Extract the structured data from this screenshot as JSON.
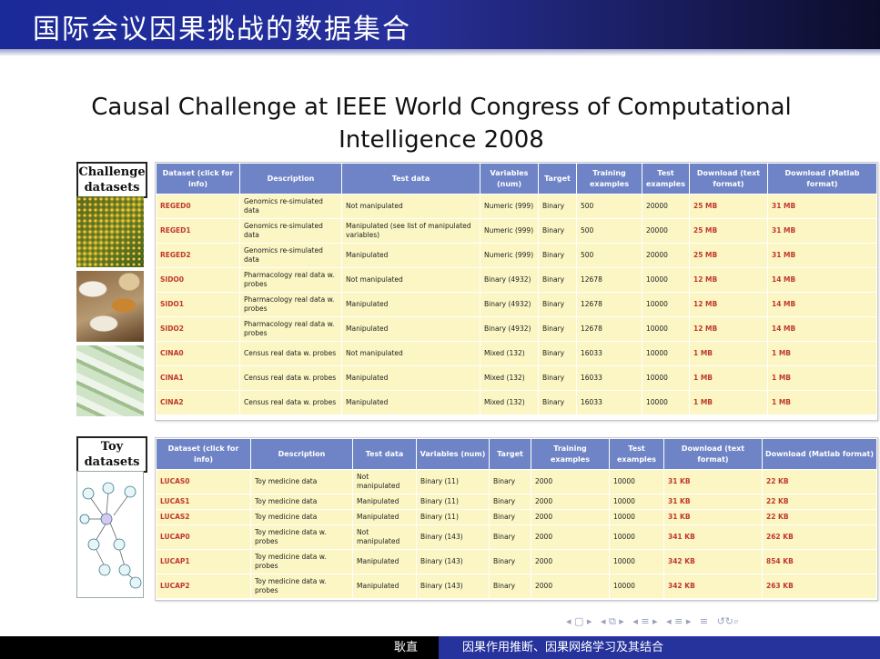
{
  "header": {
    "title": "国际会议因果挑战的数据集合"
  },
  "heading": {
    "line1": "Causal Challenge at IEEE World Congress of Computational",
    "line2": "Intelligence 2008"
  },
  "challenge": {
    "label_line1": "Challenge",
    "label_line2": "datasets",
    "columns": [
      "Dataset (click for info)",
      "Description",
      "Test data",
      "Variables (num)",
      "Target",
      "Training examples",
      "Test examples",
      "Download (text format)",
      "Download (Matlab format)"
    ],
    "rows": [
      [
        "REGED0",
        "Genomics re-simulated data",
        "Not manipulated",
        "Numeric (999)",
        "Binary",
        "500",
        "20000",
        "25 MB",
        "31 MB"
      ],
      [
        "REGED1",
        "Genomics re-simulated data",
        "Manipulated (see list of manipulated variables)",
        "Numeric (999)",
        "Binary",
        "500",
        "20000",
        "25 MB",
        "31 MB"
      ],
      [
        "REGED2",
        "Genomics re-simulated data",
        "Manipulated",
        "Numeric (999)",
        "Binary",
        "500",
        "20000",
        "25 MB",
        "31 MB"
      ],
      [
        "SIDO0",
        "Pharmacology real data w. probes",
        "Not manipulated",
        "Binary (4932)",
        "Binary",
        "12678",
        "10000",
        "12 MB",
        "14 MB"
      ],
      [
        "SIDO1",
        "Pharmacology real data w. probes",
        "Manipulated",
        "Binary (4932)",
        "Binary",
        "12678",
        "10000",
        "12 MB",
        "14 MB"
      ],
      [
        "SIDO2",
        "Pharmacology real data w. probes",
        "Manipulated",
        "Binary (4932)",
        "Binary",
        "12678",
        "10000",
        "12 MB",
        "14 MB"
      ],
      [
        "CINA0",
        "Census real data w. probes",
        "Not manipulated",
        "Mixed (132)",
        "Binary",
        "16033",
        "10000",
        "1 MB",
        "1 MB"
      ],
      [
        "CINA1",
        "Census real data w. probes",
        "Manipulated",
        "Mixed (132)",
        "Binary",
        "16033",
        "10000",
        "1 MB",
        "1 MB"
      ],
      [
        "CINA2",
        "Census real data w. probes",
        "Manipulated",
        "Mixed (132)",
        "Binary",
        "16033",
        "10000",
        "1 MB",
        "1 MB"
      ]
    ]
  },
  "toy": {
    "label_line1": "Toy",
    "label_line2": "datasets",
    "columns": [
      "Dataset (click for info)",
      "Description",
      "Test data",
      "Variables (num)",
      "Target",
      "Training examples",
      "Test examples",
      "Download (text format)",
      "Download (Matlab format)"
    ],
    "rows": [
      [
        "LUCAS0",
        "Toy medicine data",
        "Not manipulated",
        "Binary (11)",
        "Binary",
        "2000",
        "10000",
        "31 KB",
        "22 KB"
      ],
      [
        "LUCAS1",
        "Toy medicine data",
        "Manipulated",
        "Binary (11)",
        "Binary",
        "2000",
        "10000",
        "31 KB",
        "22 KB"
      ],
      [
        "LUCAS2",
        "Toy medicine data",
        "Manipulated",
        "Binary (11)",
        "Binary",
        "2000",
        "10000",
        "31 KB",
        "22 KB"
      ],
      [
        "LUCAP0",
        "Toy medicine data w. probes",
        "Not manipulated",
        "Binary (143)",
        "Binary",
        "2000",
        "10000",
        "341 KB",
        "262 KB"
      ],
      [
        "LUCAP1",
        "Toy medicine data w. probes",
        "Manipulated",
        "Binary (143)",
        "Binary",
        "2000",
        "10000",
        "342 KB",
        "854 KB"
      ],
      [
        "LUCAP2",
        "Toy medicine data w. probes",
        "Manipulated",
        "Binary (143)",
        "Binary",
        "2000",
        "10000",
        "342 KB",
        "263 KB"
      ]
    ]
  },
  "nav": {
    "icons": [
      "nav-first-icon",
      "nav-prev-icon",
      "nav-section-icon",
      "nav-subsection-icon",
      "nav-next-icon",
      "nav-align-icon",
      "nav-search-icon"
    ]
  },
  "footer": {
    "author": "耿直",
    "topic": "因果作用推断、因果网络学习及其结合"
  },
  "colors": {
    "header_blue": "#26339c",
    "table_header": "#6f84c6",
    "table_cell": "#fbf6c4",
    "link_red": "#c0392b"
  }
}
